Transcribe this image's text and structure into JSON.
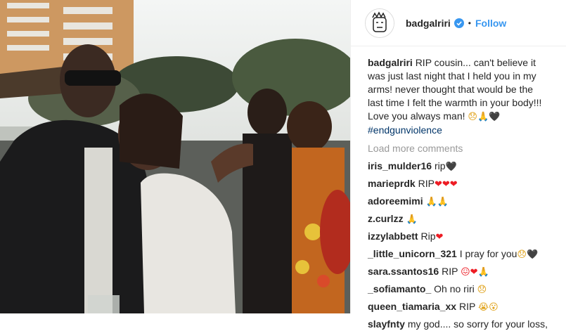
{
  "post": {
    "username": "badgalriri",
    "follow_label": "Follow",
    "separator": "•",
    "caption_text": "RIP cousin... can't believe it was just last night that I held you in my arms! never thought that would be the last time I felt the warmth in your body!!! Love you always man!",
    "caption_emoji": "😞🙏🖤",
    "hashtag": "#endgunviolence",
    "load_more": "Load more comments"
  },
  "comments": [
    {
      "user": "iris_mulder16",
      "text": "rip",
      "emoji": "🖤"
    },
    {
      "user": "marieprdk",
      "text": "RIP",
      "emoji": "❤❤❤"
    },
    {
      "user": "adoreemimi",
      "text": "",
      "emoji": "🙏🙏"
    },
    {
      "user": "z.curlzz",
      "text": "",
      "emoji": "🙏"
    },
    {
      "user": "izzylabbett",
      "text": "Rip",
      "emoji": "❤"
    },
    {
      "user": "_little_unicorn_321",
      "text": "I pray for you",
      "emoji": "😞🖤"
    },
    {
      "user": "sara.ssantos16",
      "text": "RIP",
      "emoji": "😖❤🙏"
    },
    {
      "user": "_sofiamanto_",
      "text": "Oh no riri",
      "emoji": "😞"
    },
    {
      "user": "queen_tiamaria_xx",
      "text": "RIP",
      "emoji": "😭😮"
    },
    {
      "user": "slayfnty",
      "text": "my god.... so sorry for your loss,",
      "emoji": ""
    }
  ],
  "colors": {
    "accent": "#3897f0",
    "heart": "#ed1c24",
    "hashtag": "#003569",
    "muted": "#999999"
  }
}
